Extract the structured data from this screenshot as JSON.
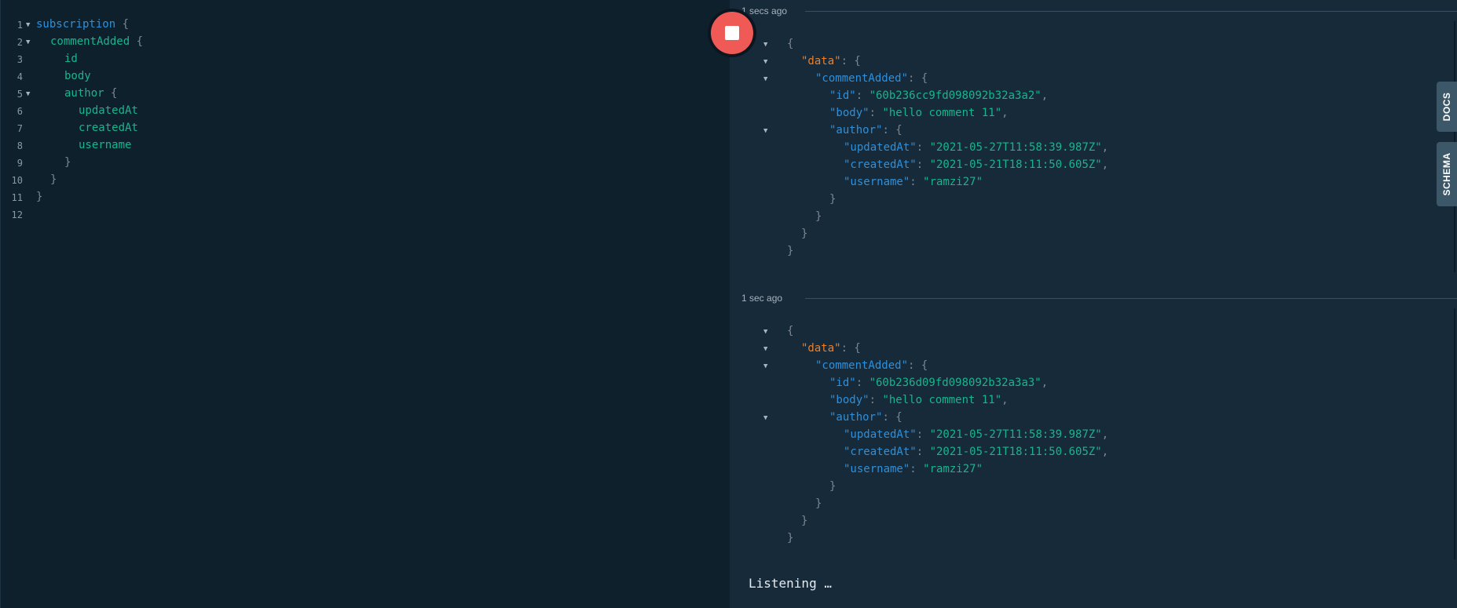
{
  "query_editor": {
    "lines": [
      {
        "num": "1",
        "fold": true,
        "indent": 0,
        "parts": [
          {
            "t": "subscription",
            "c": "kw"
          },
          {
            "t": " {",
            "c": "pun"
          }
        ]
      },
      {
        "num": "2",
        "fold": true,
        "indent": 1,
        "parts": [
          {
            "t": "commentAdded",
            "c": "fld"
          },
          {
            "t": " {",
            "c": "pun"
          }
        ]
      },
      {
        "num": "3",
        "fold": false,
        "indent": 2,
        "parts": [
          {
            "t": "id",
            "c": "fld"
          }
        ]
      },
      {
        "num": "4",
        "fold": false,
        "indent": 2,
        "parts": [
          {
            "t": "body",
            "c": "fld"
          }
        ]
      },
      {
        "num": "5",
        "fold": true,
        "indent": 2,
        "parts": [
          {
            "t": "author",
            "c": "fld"
          },
          {
            "t": " {",
            "c": "pun"
          }
        ]
      },
      {
        "num": "6",
        "fold": false,
        "indent": 3,
        "parts": [
          {
            "t": "updatedAt",
            "c": "fld"
          }
        ]
      },
      {
        "num": "7",
        "fold": false,
        "indent": 3,
        "parts": [
          {
            "t": "createdAt",
            "c": "fld"
          }
        ]
      },
      {
        "num": "8",
        "fold": false,
        "indent": 3,
        "parts": [
          {
            "t": "username",
            "c": "fld"
          }
        ]
      },
      {
        "num": "9",
        "fold": false,
        "indent": 2,
        "parts": [
          {
            "t": "}",
            "c": "pun"
          }
        ]
      },
      {
        "num": "10",
        "fold": false,
        "indent": 1,
        "parts": [
          {
            "t": "}",
            "c": "pun"
          }
        ]
      },
      {
        "num": "11",
        "fold": false,
        "indent": 0,
        "parts": [
          {
            "t": "}",
            "c": "pun"
          }
        ]
      },
      {
        "num": "12",
        "fold": false,
        "indent": 0,
        "parts": []
      }
    ]
  },
  "stop_button": {
    "icon": "stop-icon",
    "color": "#ef5a57"
  },
  "results": [
    {
      "timestamp": "1 secs ago",
      "lines": [
        {
          "fold": true,
          "indent": 0,
          "parts": [
            {
              "t": "{",
              "c": "p"
            }
          ]
        },
        {
          "fold": true,
          "indent": 1,
          "parts": [
            {
              "t": "\"data\"",
              "c": "korange"
            },
            {
              "t": ": {",
              "c": "p"
            }
          ]
        },
        {
          "fold": true,
          "indent": 2,
          "parts": [
            {
              "t": "\"commentAdded\"",
              "c": "k"
            },
            {
              "t": ": {",
              "c": "p"
            }
          ]
        },
        {
          "fold": false,
          "indent": 3,
          "parts": [
            {
              "t": "\"id\"",
              "c": "k"
            },
            {
              "t": ": ",
              "c": "p"
            },
            {
              "t": "\"60b236cc9fd098092b32a3a2\"",
              "c": "s"
            },
            {
              "t": ",",
              "c": "p"
            }
          ]
        },
        {
          "fold": false,
          "indent": 3,
          "parts": [
            {
              "t": "\"body\"",
              "c": "k"
            },
            {
              "t": ": ",
              "c": "p"
            },
            {
              "t": "\"hello comment 11\"",
              "c": "s"
            },
            {
              "t": ",",
              "c": "p"
            }
          ]
        },
        {
          "fold": true,
          "indent": 3,
          "parts": [
            {
              "t": "\"author\"",
              "c": "k"
            },
            {
              "t": ": {",
              "c": "p"
            }
          ]
        },
        {
          "fold": false,
          "indent": 4,
          "parts": [
            {
              "t": "\"updatedAt\"",
              "c": "k"
            },
            {
              "t": ": ",
              "c": "p"
            },
            {
              "t": "\"2021-05-27T11:58:39.987Z\"",
              "c": "s"
            },
            {
              "t": ",",
              "c": "p"
            }
          ]
        },
        {
          "fold": false,
          "indent": 4,
          "parts": [
            {
              "t": "\"createdAt\"",
              "c": "k"
            },
            {
              "t": ": ",
              "c": "p"
            },
            {
              "t": "\"2021-05-21T18:11:50.605Z\"",
              "c": "s"
            },
            {
              "t": ",",
              "c": "p"
            }
          ]
        },
        {
          "fold": false,
          "indent": 4,
          "parts": [
            {
              "t": "\"username\"",
              "c": "k"
            },
            {
              "t": ": ",
              "c": "p"
            },
            {
              "t": "\"ramzi27\"",
              "c": "s"
            }
          ]
        },
        {
          "fold": false,
          "indent": 3,
          "parts": [
            {
              "t": "}",
              "c": "p"
            }
          ]
        },
        {
          "fold": false,
          "indent": 2,
          "parts": [
            {
              "t": "}",
              "c": "p"
            }
          ]
        },
        {
          "fold": false,
          "indent": 1,
          "parts": [
            {
              "t": "}",
              "c": "p"
            }
          ]
        },
        {
          "fold": false,
          "indent": 0,
          "parts": [
            {
              "t": "}",
              "c": "p"
            }
          ]
        }
      ]
    },
    {
      "timestamp": "1 sec ago",
      "lines": [
        {
          "fold": true,
          "indent": 0,
          "parts": [
            {
              "t": "{",
              "c": "p"
            }
          ]
        },
        {
          "fold": true,
          "indent": 1,
          "parts": [
            {
              "t": "\"data\"",
              "c": "korange"
            },
            {
              "t": ": {",
              "c": "p"
            }
          ]
        },
        {
          "fold": true,
          "indent": 2,
          "parts": [
            {
              "t": "\"commentAdded\"",
              "c": "k"
            },
            {
              "t": ": {",
              "c": "p"
            }
          ]
        },
        {
          "fold": false,
          "indent": 3,
          "parts": [
            {
              "t": "\"id\"",
              "c": "k"
            },
            {
              "t": ": ",
              "c": "p"
            },
            {
              "t": "\"60b236d09fd098092b32a3a3\"",
              "c": "s"
            },
            {
              "t": ",",
              "c": "p"
            }
          ]
        },
        {
          "fold": false,
          "indent": 3,
          "parts": [
            {
              "t": "\"body\"",
              "c": "k"
            },
            {
              "t": ": ",
              "c": "p"
            },
            {
              "t": "\"hello comment 11\"",
              "c": "s"
            },
            {
              "t": ",",
              "c": "p"
            }
          ]
        },
        {
          "fold": true,
          "indent": 3,
          "parts": [
            {
              "t": "\"author\"",
              "c": "k"
            },
            {
              "t": ": {",
              "c": "p"
            }
          ]
        },
        {
          "fold": false,
          "indent": 4,
          "parts": [
            {
              "t": "\"updatedAt\"",
              "c": "k"
            },
            {
              "t": ": ",
              "c": "p"
            },
            {
              "t": "\"2021-05-27T11:58:39.987Z\"",
              "c": "s"
            },
            {
              "t": ",",
              "c": "p"
            }
          ]
        },
        {
          "fold": false,
          "indent": 4,
          "parts": [
            {
              "t": "\"createdAt\"",
              "c": "k"
            },
            {
              "t": ": ",
              "c": "p"
            },
            {
              "t": "\"2021-05-21T18:11:50.605Z\"",
              "c": "s"
            },
            {
              "t": ",",
              "c": "p"
            }
          ]
        },
        {
          "fold": false,
          "indent": 4,
          "parts": [
            {
              "t": "\"username\"",
              "c": "k"
            },
            {
              "t": ": ",
              "c": "p"
            },
            {
              "t": "\"ramzi27\"",
              "c": "s"
            }
          ]
        },
        {
          "fold": false,
          "indent": 3,
          "parts": [
            {
              "t": "}",
              "c": "p"
            }
          ]
        },
        {
          "fold": false,
          "indent": 2,
          "parts": [
            {
              "t": "}",
              "c": "p"
            }
          ]
        },
        {
          "fold": false,
          "indent": 1,
          "parts": [
            {
              "t": "}",
              "c": "p"
            }
          ]
        },
        {
          "fold": false,
          "indent": 0,
          "parts": [
            {
              "t": "}",
              "c": "p"
            }
          ]
        }
      ]
    }
  ],
  "status": {
    "listening": "Listening …"
  },
  "side_tabs": {
    "docs": "DOCS",
    "schema": "SCHEMA"
  }
}
